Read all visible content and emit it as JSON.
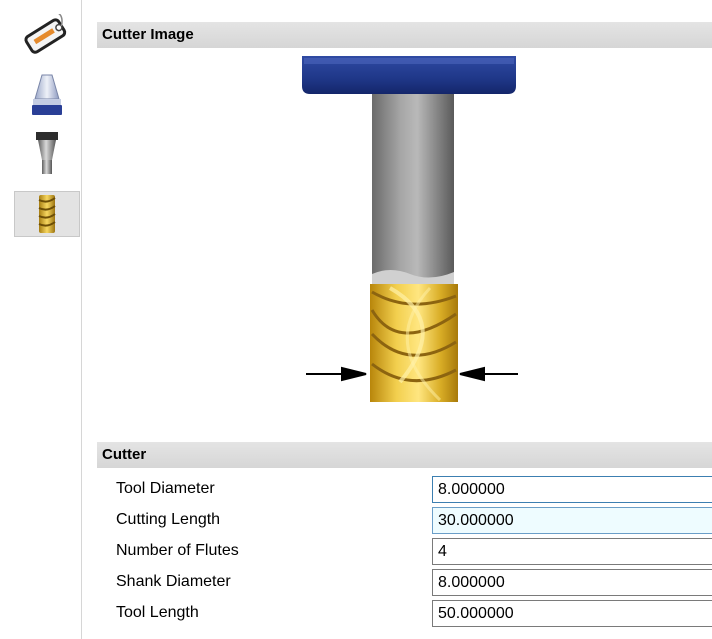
{
  "sidebar": {
    "items": [
      {
        "icon": "tool-tag-icon"
      },
      {
        "icon": "tool-holder-icon"
      },
      {
        "icon": "tool-shank-icon"
      },
      {
        "icon": "cutter-icon",
        "selected": true
      }
    ]
  },
  "image_section": {
    "title": "Cutter Image"
  },
  "cutter_section": {
    "title": "Cutter",
    "fields": [
      {
        "label": "Tool Diameter",
        "value": "8.000000"
      },
      {
        "label": "Cutting Length",
        "value": "30.000000"
      },
      {
        "label": "Number of Flutes",
        "value": "4"
      },
      {
        "label": "Shank Diameter",
        "value": "8.000000"
      },
      {
        "label": "Tool Length",
        "value": "50.000000"
      }
    ]
  },
  "colors": {
    "holder_blue": "#233d8f",
    "flute_gold": "#d9b431",
    "shank_gray": "#8c8c8c"
  }
}
